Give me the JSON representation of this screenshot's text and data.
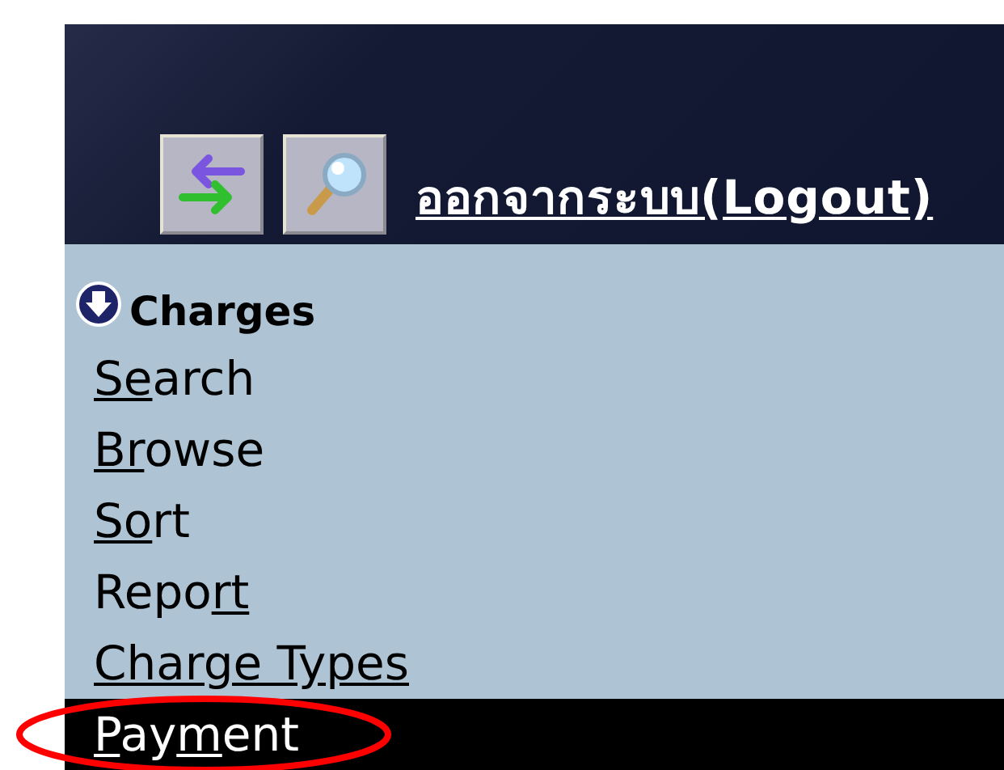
{
  "header": {
    "logout_link": "ออกจากระบบ(Logout)"
  },
  "menu": {
    "title": "Charges",
    "items": [
      {
        "parts": [
          {
            "text": "Se",
            "underlined": true
          },
          {
            "text": "arch",
            "underlined": false
          }
        ],
        "selected": false,
        "circled": false
      },
      {
        "parts": [
          {
            "text": "Br",
            "underlined": true
          },
          {
            "text": "owse",
            "underlined": false
          }
        ],
        "selected": false,
        "circled": false
      },
      {
        "parts": [
          {
            "text": "So",
            "underlined": true
          },
          {
            "text": "rt",
            "underlined": false
          }
        ],
        "selected": false,
        "circled": false
      },
      {
        "parts": [
          {
            "text": "Repo",
            "underlined": false
          },
          {
            "text": "rt",
            "underlined": true
          }
        ],
        "selected": false,
        "circled": false
      },
      {
        "parts": [
          {
            "text": "Charge Types",
            "underlined": true
          }
        ],
        "selected": false,
        "circled": false
      },
      {
        "parts": [
          {
            "text": "P",
            "underlined": true
          },
          {
            "text": "ay",
            "underlined": false
          },
          {
            "text": "m",
            "underlined": true
          },
          {
            "text": "ent",
            "underlined": false
          }
        ],
        "selected": true,
        "circled": true
      }
    ]
  }
}
